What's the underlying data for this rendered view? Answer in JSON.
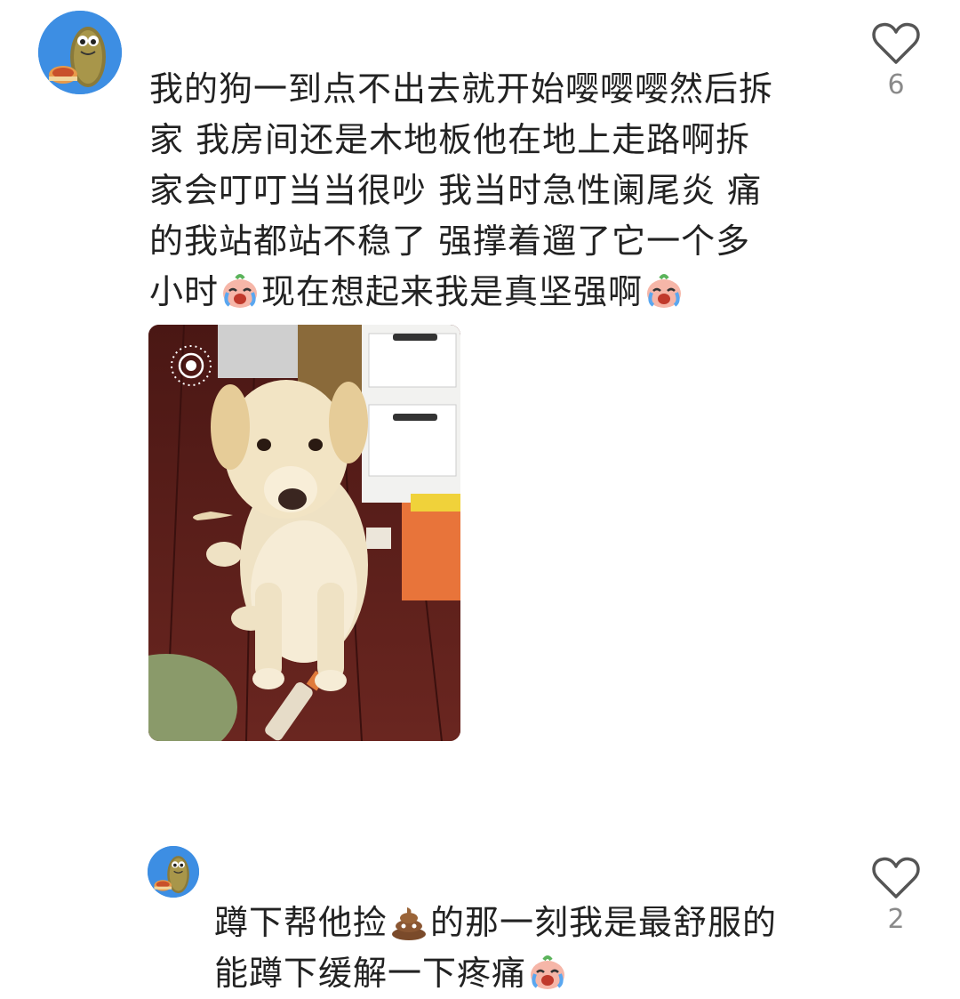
{
  "comments": [
    {
      "avatar": "cartoon-character-avatar",
      "text_lines": [
        "我的狗一到点不出去就开始嘤嘤嘤然后拆",
        "家 我房间还是木地板他在地上走路啊拆",
        "家会叮叮当当很吵 我当时急性阑尾炎 痛",
        "的我站都站不稳了 强撑着遛了它一个多"
      ],
      "last_line": {
        "part1": "小时",
        "emoji1": "crying-face-emoji",
        "part2": "现在想起来我是真坚强啊",
        "emoji2": "crying-face-emoji"
      },
      "image": {
        "description_icon": "live-photo-icon",
        "type": "photo"
      },
      "like_icon": "heart-outline-icon",
      "like_count": "6"
    },
    {
      "avatar": "cartoon-character-avatar",
      "line1": {
        "part1": "蹲下帮他捡",
        "emoji": "poop-emoji",
        "part2": "的那一刻我是最舒服的"
      },
      "line2": {
        "part1": "能蹲下缓解一下疼痛",
        "emoji": "crying-face-emoji"
      },
      "like_icon": "heart-outline-icon",
      "like_count": "2"
    }
  ]
}
